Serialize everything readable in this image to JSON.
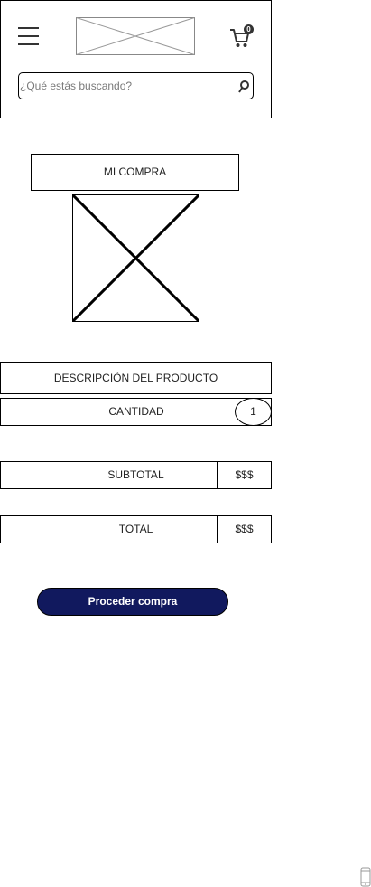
{
  "header": {
    "menu_icon": "hamburger-menu-icon",
    "logo_icon": "image-placeholder",
    "cart": {
      "icon": "shopping-cart-icon",
      "badge_count": "0"
    },
    "search": {
      "placeholder": "¿Qué estás buscando?",
      "value": "",
      "icon": "search-icon"
    }
  },
  "main": {
    "title": "MI COMPRA",
    "product_image_icon": "image-placeholder",
    "description_label": "DESCRIPCIÓN DEL PRODUCTO",
    "quantity": {
      "label": "CANTIDAD",
      "value": "1"
    },
    "subtotal": {
      "label": "SUBTOTAL",
      "value": "$$$"
    },
    "total": {
      "label": "TOTAL",
      "value": "$$$"
    },
    "proceed_button_label": "Proceder compra"
  },
  "colors": {
    "button_bg": "#11195e",
    "button_text": "#ffffff",
    "border": "#000000"
  },
  "footer": {
    "device_icon": "mobile-phone-icon"
  }
}
